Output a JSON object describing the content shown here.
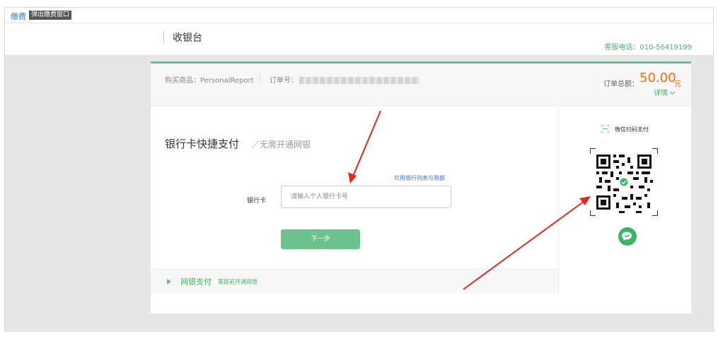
{
  "top_tab": {
    "link": "缴费",
    "badge": "弹出缴费窗口"
  },
  "header": {
    "title": "收银台",
    "hotline": "客服电话：010-56419199"
  },
  "order": {
    "product_label": "购买商品：",
    "product_name": "PersonalReport",
    "order_no_label": "订单号：",
    "total_label": "订单总额：",
    "total_amount": "50.00",
    "currency": "元",
    "details_label": "详情"
  },
  "quickpay": {
    "title": "银行卡快捷支付",
    "subtitle": "／无需开通网银",
    "bank_list_link": "可用银行列表与限额",
    "card_label": "银行卡",
    "card_placeholder": "请输入个人银行卡号",
    "next_button": "下一步"
  },
  "netbank": {
    "title": "网银支付",
    "note": "需提前开通网银"
  },
  "wechat": {
    "label": "微信扫码支付"
  },
  "colors": {
    "brand_green": "#62c385",
    "amount_orange": "#ff6a00",
    "link_blue": "#3b78c4",
    "arrow_red": "#e8251f"
  },
  "icons": [
    "scan-icon",
    "qr-code",
    "wechat-icon",
    "chevron-down-icon",
    "triangle-right-icon"
  ]
}
